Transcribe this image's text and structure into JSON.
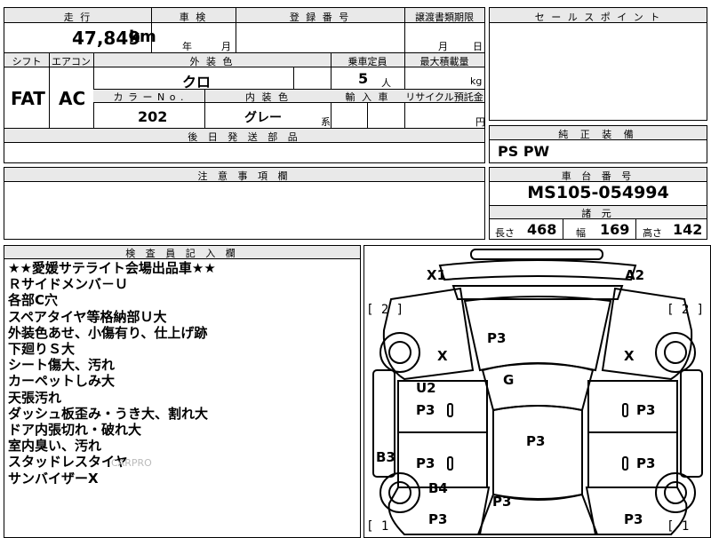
{
  "top": {
    "mileage_label": "走 行",
    "mileage_value": "47,849",
    "mileage_unit": "km",
    "inspection_label": "車 検",
    "inspection_year": "年",
    "inspection_month": "月",
    "registration_label": "登 録 番 号",
    "transfer_label": "譲渡書類期限",
    "transfer_month": "月",
    "transfer_day": "日"
  },
  "row2": {
    "shift_label": "シフト",
    "shift_value": "FAT",
    "ac_label": "エアコン",
    "ac_value": "AC",
    "exterior_label": "外 装 色",
    "exterior_value": "クロ",
    "capacity_label": "乗車定員",
    "capacity_value": "5",
    "capacity_unit": "人",
    "maxload_label": "最大積載量",
    "maxload_unit": "kg",
    "color_no_label": "カ ラ ー N o .",
    "color_no_value": "202",
    "interior_label": "内 装 色",
    "interior_value": "グレー",
    "interior_unit": "系",
    "import_label": "輸 入 車",
    "recycle_label": "リサイクル預託金",
    "recycle_unit": "円"
  },
  "later_parts_label": "後 日 発 送 部 品",
  "caution_label": "注 意 事 項 欄",
  "sales_point_label": "セ ー ル ス ポ イ ン ト",
  "equipment": {
    "label": "純 正 装 備",
    "value": "PS PW"
  },
  "chassis": {
    "label": "車 台 番 号",
    "value": "MS105-054994"
  },
  "dimensions": {
    "label": "諸 元",
    "length_label": "長さ",
    "length_value": "468",
    "width_label": "幅",
    "width_value": "169",
    "height_label": "高さ",
    "height_value": "142"
  },
  "inspector": {
    "label": "検 査 員 記 入 欄",
    "notes": [
      "★★愛媛サテライト会場出品車★★",
      "Ｒサイドメンバ－Ｕ",
      "各部C穴",
      "スペアタイヤ等格納部Ｕ大",
      "外装色あせ、小傷有り、仕上げ跡",
      "下廻りＳ大",
      "シート傷大、汚れ",
      "カーペットしみ大",
      "天張汚れ",
      "ダッシュ板歪み・うき大、割れ大",
      "ドア内張切れ・破れ大",
      "室内臭い、汚れ",
      "スタッドレスタイヤ",
      "サンバイザーX"
    ],
    "watermark": "CARPRO"
  },
  "diagram": {
    "marks": {
      "x1": "X1",
      "a2": "A2",
      "b2l": "[ 2 ]",
      "b2r": "[ 2 ]",
      "b1l": "[ 1",
      "b1r": "[ 1",
      "hood": "P3",
      "xl": "X",
      "xr": "X",
      "g": "G",
      "u2": "U2",
      "fdl": "P3",
      "fdr": "P3",
      "roof": "P3",
      "b3": "B3",
      "rdl": "P3",
      "rdr": "P3",
      "b4": "B4",
      "rql": "P3",
      "rqr": "P3",
      "trunk": "P3"
    }
  }
}
